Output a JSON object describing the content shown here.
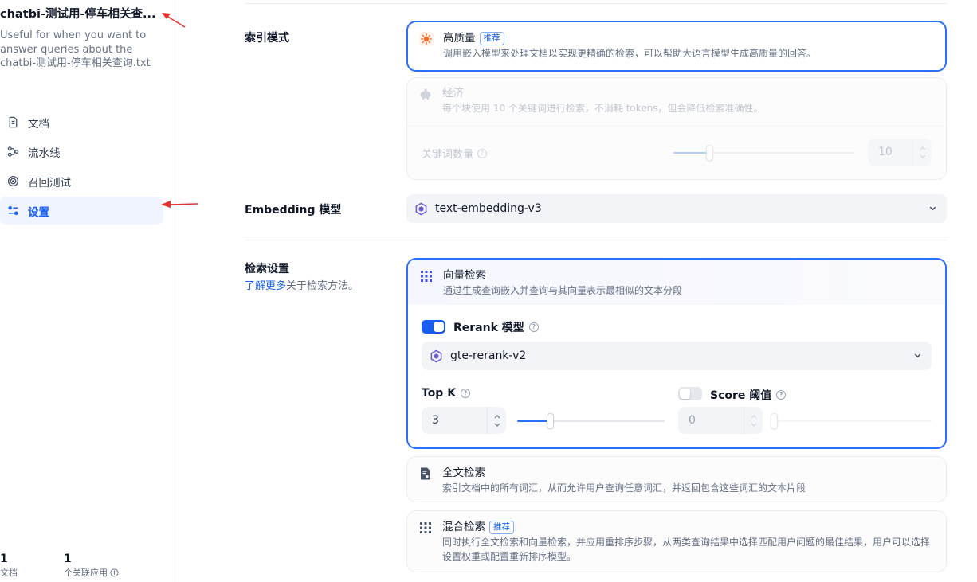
{
  "sidebar": {
    "kb_title": "chatbi-测试用-停车相关查...",
    "kb_desc": "Useful for when you want to answer queries about the chatbi-测试用-停车相关查询.txt",
    "nav": [
      {
        "label": "文档",
        "icon": "document-icon"
      },
      {
        "label": "流水线",
        "icon": "pipeline-icon"
      },
      {
        "label": "召回测试",
        "icon": "target-icon"
      },
      {
        "label": "设置",
        "icon": "settings-sliders-icon"
      }
    ],
    "stats": [
      {
        "value": "1",
        "label": "文档"
      },
      {
        "value": "1",
        "label": "个关联应用"
      }
    ]
  },
  "index_mode": {
    "label": "索引模式",
    "high_quality": {
      "title": "高质量",
      "badge": "推荐",
      "desc": "调用嵌入模型来处理文档以实现更精确的检索，可以帮助大语言模型生成高质量的回答。"
    },
    "economy": {
      "title": "经济",
      "desc": "每个块使用 10 个关键词进行检索，不消耗 tokens，但会降低检索准确性。",
      "keyword_label": "关键词数量",
      "keyword_value": "10",
      "keyword_fraction": 0.2
    }
  },
  "embedding": {
    "label": "Embedding 模型",
    "value": "text-embedding-v3"
  },
  "retrieval": {
    "label": "检索设置",
    "learn_more": "了解更多",
    "learn_more_suffix": "关于检索方法。",
    "vector": {
      "title": "向量检索",
      "desc": "通过生成查询嵌入并查询与其向量表示最相似的文本分段",
      "rerank_label": "Rerank 模型",
      "rerank_enabled": true,
      "rerank_model": "gte-rerank-v2",
      "topk_label": "Top K",
      "topk_value": "3",
      "topk_fraction": 0.22,
      "score_label": "Score 阈值",
      "score_enabled": false,
      "score_value": "0",
      "score_fraction": 0
    },
    "fulltext": {
      "title": "全文检索",
      "desc": "索引文档中的所有词汇，从而允许用户查询任意词汇，并返回包含这些词汇的文本片段"
    },
    "hybrid": {
      "title": "混合检索",
      "badge": "推荐",
      "desc": "同时执行全文检索和向量检索，并应用重排序步骤，从两类查询结果中选择匹配用户问题的最佳结果，用户可以选择设置权重或配置重新排序模型。"
    }
  },
  "colors": {
    "accent": "#2970ff",
    "annotation_arrow": "#e5322d"
  }
}
